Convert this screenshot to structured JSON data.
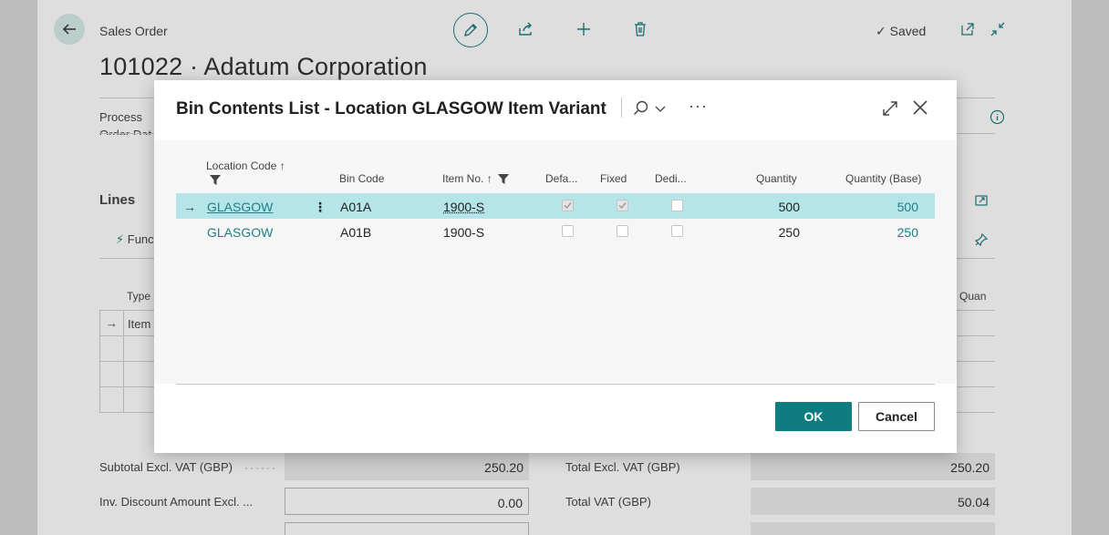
{
  "background": {
    "breadcrumb": "Sales Order",
    "title": "101022 · Adatum Corporation",
    "saved_label": "Saved",
    "process_tab": "Process",
    "order_date_fragment": "Order Dat",
    "lines_heading": "Lines",
    "functions_fragment": "Func",
    "type_header": "Type",
    "item_fragment": "Item",
    "qty_fragment": "d Quan",
    "totals": {
      "subtotal_label": "Subtotal Excl. VAT (GBP)",
      "subtotal_value": "250.20",
      "inv_discount_label": "Inv. Discount Amount Excl. ...",
      "inv_discount_value": "0.00",
      "total_excl_label": "Total Excl. VAT (GBP)",
      "total_excl_value": "250.20",
      "total_vat_label": "Total VAT (GBP)",
      "total_vat_value": "50.04"
    }
  },
  "dialog": {
    "title": "Bin Contents List - Location GLASGOW Item Variant",
    "columns": {
      "location_code": "Location Code",
      "bin_code": "Bin Code",
      "item_no": "Item No.",
      "default": "Defa...",
      "fixed": "Fixed",
      "dedicated": "Dedi...",
      "quantity": "Quantity",
      "quantity_base": "Quantity (Base)"
    },
    "sort_arrow": "↑",
    "row_arrow": "→",
    "row_menu": "⋮",
    "rows": [
      {
        "location": "GLASGOW",
        "bin": "A01A",
        "item": "1900-S",
        "default": true,
        "fixed": true,
        "dedicated": false,
        "quantity": "500",
        "quantity_base": "500"
      },
      {
        "location": "GLASGOW",
        "bin": "A01B",
        "item": "1900-S",
        "default": false,
        "fixed": false,
        "dedicated": false,
        "quantity": "250",
        "quantity_base": "250"
      }
    ],
    "ok_label": "OK",
    "cancel_label": "Cancel"
  },
  "colors": {
    "accent": "#0e7c81",
    "selected_row": "#b5e5e8",
    "link": "#1e7f84"
  }
}
